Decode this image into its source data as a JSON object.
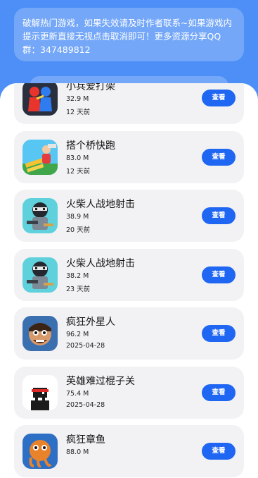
{
  "notice": {
    "text": "破解热门游戏，如果失效请及时作者联系~如果游戏内提示更新直接无视点击取消即可！更多资源分享QQ群：347489812"
  },
  "colors": {
    "header_bg": "#4d8ff7",
    "button": "#1f66f2",
    "card_bg": "#f2f2f4"
  },
  "apps": [
    {
      "name": "小兵爱打架",
      "size": "32.9 M",
      "date": "12 天前",
      "button": "查看",
      "icon": "stickman-fight-icon"
    },
    {
      "name": "搭个桥快跑",
      "size": "83.0 M",
      "date": "12 天前",
      "button": "查看",
      "icon": "bridge-runner-icon"
    },
    {
      "name": "火柴人战地射击",
      "size": "38.9 M",
      "date": "20 天前",
      "button": "查看",
      "icon": "ninja-shooter-icon"
    },
    {
      "name": "火柴人战地射击",
      "size": "38.2 M",
      "date": "23 天前",
      "button": "查看",
      "icon": "ninja-shooter-icon"
    },
    {
      "name": "疯狂外星人",
      "size": "96.2 M",
      "date": "2025-04-28",
      "button": "查看",
      "icon": "crazy-alien-icon"
    },
    {
      "name": "英雄难过棍子关",
      "size": "75.4 M",
      "date": "2025-04-28",
      "button": "查看",
      "icon": "stick-hero-icon"
    },
    {
      "name": "疯狂章鱼",
      "size": "88.0 M",
      "date": "",
      "button": "查看",
      "icon": "crazy-octopus-icon"
    }
  ]
}
